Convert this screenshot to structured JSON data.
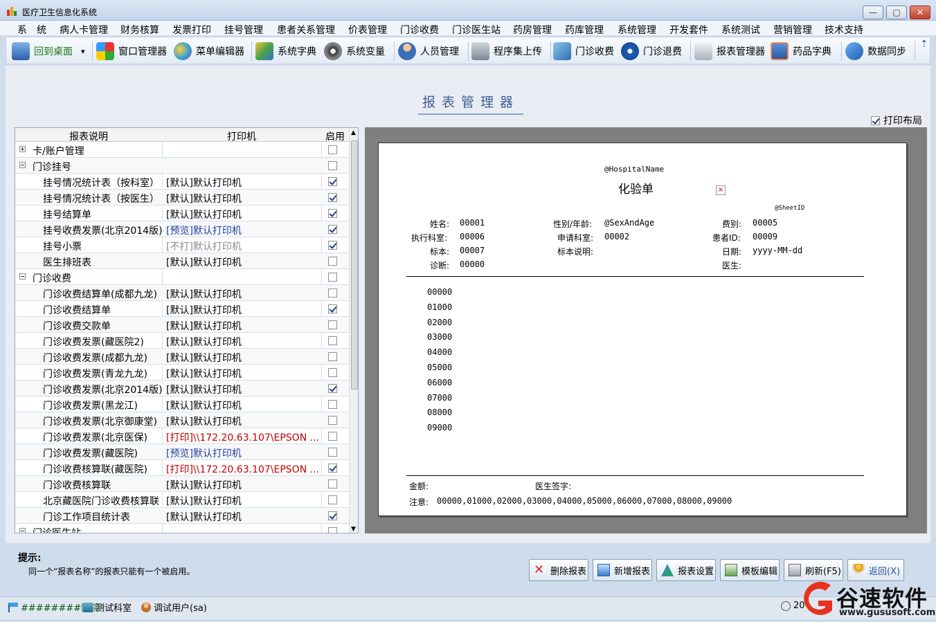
{
  "window": {
    "title": "医疗卫生信息化系统",
    "min": "—",
    "max": "▢",
    "close": "✕"
  },
  "menu": [
    "系　统",
    "病人卡管理",
    "财务核算",
    "发票打印",
    "挂号管理",
    "患者关系管理",
    "价表管理",
    "门诊收费",
    "门诊医生站",
    "药房管理",
    "药库管理",
    "系统管理",
    "开发套件",
    "系统测试",
    "营销管理",
    "技术支持"
  ],
  "toolbar": [
    "回到桌面",
    "窗口管理器",
    "菜单编辑器",
    "系统字典",
    "系统变量",
    "人员管理",
    "程序集上传",
    "门诊收费",
    "门诊退费",
    "报表管理器",
    "药品字典",
    "数据同步"
  ],
  "toolbar_dropdown": "▾",
  "toolbar_overflow": "⇡",
  "page_title": "报表管理器",
  "print_layout": {
    "label": "打印布局",
    "checked": true
  },
  "grid": {
    "headers": [
      "报表说明",
      "打印机",
      "启用"
    ],
    "rows": [
      {
        "name": "卡/账户管理",
        "printer": "",
        "enabled": false,
        "group": true,
        "expanded": false
      },
      {
        "name": "门诊挂号",
        "printer": "",
        "enabled": false,
        "group": true,
        "expanded": true
      },
      {
        "name": "挂号情况统计表（按科室）",
        "printer": "[默认]默认打印机",
        "enabled": true
      },
      {
        "name": "挂号情况统计表（按医生）",
        "printer": "[默认]默认打印机",
        "enabled": true
      },
      {
        "name": "挂号结算单",
        "printer": "[默认]默认打印机",
        "enabled": true
      },
      {
        "name": "挂号收费发票(北京2014版)",
        "printer": "[预览]默认打印机",
        "enabled": true,
        "style": "blue"
      },
      {
        "name": "挂号小票",
        "printer": "[不打]默认打印机",
        "enabled": true,
        "style": "gray"
      },
      {
        "name": "医生排班表",
        "printer": "[默认]默认打印机",
        "enabled": false
      },
      {
        "name": "门诊收费",
        "printer": "",
        "enabled": false,
        "group": true,
        "expanded": true
      },
      {
        "name": "门诊收费结算单(成都九龙)",
        "printer": "[默认]默认打印机",
        "enabled": false
      },
      {
        "name": "门诊收费结算单",
        "printer": "[默认]默认打印机",
        "enabled": true
      },
      {
        "name": "门诊收费交款单",
        "printer": "[默认]默认打印机",
        "enabled": false
      },
      {
        "name": "门诊收费发票(藏医院2)",
        "printer": "[默认]默认打印机",
        "enabled": false
      },
      {
        "name": "门诊收费发票(成都九龙)",
        "printer": "[默认]默认打印机",
        "enabled": false
      },
      {
        "name": "门诊收费发票(青龙九龙)",
        "printer": "[默认]默认打印机",
        "enabled": false
      },
      {
        "name": "门诊收费发票(北京2014版)",
        "printer": "[默认]默认打印机",
        "enabled": true
      },
      {
        "name": "门诊收费发票(黑龙江)",
        "printer": "[默认]默认打印机",
        "enabled": false
      },
      {
        "name": "门诊收费发票(北京御康堂)",
        "printer": "[默认]默认打印机",
        "enabled": false
      },
      {
        "name": "门诊收费发票(北京医保)",
        "printer": "[打印]\\\\172.20.63.107\\EPSON ...",
        "enabled": false,
        "style": "red"
      },
      {
        "name": "门诊收费发票(藏医院)",
        "printer": "[预览]默认打印机",
        "enabled": false,
        "style": "blue"
      },
      {
        "name": "门诊收费核算联(藏医院)",
        "printer": "[打印]\\\\172.20.63.107\\EPSON ...",
        "enabled": true,
        "style": "red"
      },
      {
        "name": "门诊收费核算联",
        "printer": "[默认]默认打印机",
        "enabled": false
      },
      {
        "name": "北京藏医院门诊收费核算联",
        "printer": "[默认]默认打印机",
        "enabled": false
      },
      {
        "name": "门诊工作项目统计表",
        "printer": "[默认]默认打印机",
        "enabled": true
      },
      {
        "name": "门诊医生站",
        "printer": "",
        "enabled": false,
        "group": true,
        "expanded": true
      }
    ]
  },
  "preview": {
    "hospital": "@HospitalName",
    "title": "化验单",
    "sheet_id": "@SheetID",
    "fields": [
      {
        "label": "姓名:",
        "value": "00001"
      },
      {
        "label": "性别/年龄:",
        "value": "@SexAndAge"
      },
      {
        "label": "费别:",
        "value": "00005"
      },
      {
        "label": "执行科室:",
        "value": "00006"
      },
      {
        "label": "申请科室:",
        "value": "00002"
      },
      {
        "label": "患者ID:",
        "value": "00009"
      },
      {
        "label": "标本:",
        "value": "00007"
      },
      {
        "label": "标本说明:",
        "value": ""
      },
      {
        "label": "日期:",
        "value": "yyyy-MM-dd"
      },
      {
        "label": "诊断:",
        "value": "00000"
      },
      {
        "label": "医生:",
        "value": ""
      }
    ],
    "items": [
      "00000",
      "01000",
      "02000",
      "03000",
      "04000",
      "05000",
      "06000",
      "07000",
      "08000",
      "09000"
    ],
    "amount_label": "金额:",
    "doctor_sign_label": "医生签字:",
    "note_label": "注意:",
    "note_value": "00000,01000,02000,03000,04000,05000,06000,07000,08000,09000"
  },
  "hint": {
    "title": "提示:",
    "text": "同一个“报表名称”的报表只能有一个被启用。"
  },
  "buttons": [
    "删除报表",
    "新增报表",
    "报表设置",
    "模板编辑",
    "刷新(F5)",
    "返回(X)"
  ],
  "status": {
    "hospital": "########医院",
    "dept": "测试科室",
    "user": "调试用户(sa)",
    "clock_partial": "20"
  },
  "watermark": {
    "brand": "谷速软件",
    "url": "www.gususoft.com"
  },
  "colors": {
    "accent": "#3d5f94",
    "red_printer": "#c00000",
    "blue_printer": "#1f3fa0",
    "gray_printer": "#8a8a8a"
  }
}
